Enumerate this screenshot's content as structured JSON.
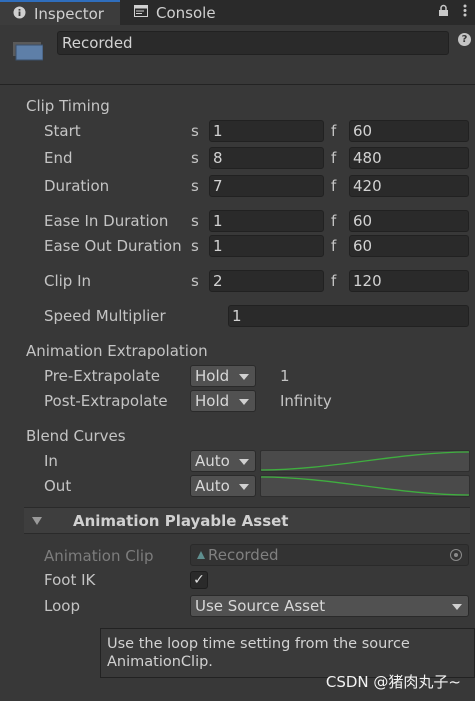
{
  "tabs": [
    {
      "label": "Inspector",
      "icon": "info-icon"
    },
    {
      "label": "Console",
      "icon": "console-icon"
    }
  ],
  "header": {
    "name_value": "Recorded",
    "help_glyph": "?"
  },
  "clip_timing": {
    "title": "Clip Timing",
    "s_unit": "s",
    "f_unit": "f",
    "start": {
      "label": "Start",
      "s": "1",
      "f": "60"
    },
    "end": {
      "label": "End",
      "s": "8",
      "f": "480"
    },
    "duration": {
      "label": "Duration",
      "s": "7",
      "f": "420"
    },
    "ease_in": {
      "label": "Ease In Duration",
      "s": "1",
      "f": "60"
    },
    "ease_out": {
      "label": "Ease Out Duration",
      "s": "1",
      "f": "60"
    },
    "clip_in": {
      "label": "Clip In",
      "s": "2",
      "f": "120"
    },
    "speed": {
      "label": "Speed Multiplier",
      "value": "1"
    }
  },
  "extrapolation": {
    "title": "Animation Extrapolation",
    "pre": {
      "label": "Pre-Extrapolate",
      "mode": "Hold",
      "value": "1"
    },
    "post": {
      "label": "Post-Extrapolate",
      "mode": "Hold",
      "value": "Infinity"
    }
  },
  "blend_curves": {
    "title": "Blend Curves",
    "in": {
      "label": "In",
      "mode": "Auto"
    },
    "out": {
      "label": "Out",
      "mode": "Auto"
    },
    "curve_color": "#3fae3f"
  },
  "playable_asset": {
    "title": "Animation Playable Asset",
    "clip_label": "Animation Clip",
    "clip_value": "Recorded",
    "foot_ik_label": "Foot IK",
    "foot_ik_checked": true,
    "check_glyph": "✓",
    "loop_label": "Loop",
    "loop_value": "Use Source Asset"
  },
  "tooltip": {
    "line1": "Use the loop time setting from the source",
    "line2": "AnimationClip."
  },
  "watermark": "CSDN @猪肉丸子~",
  "colors": {
    "accent": "#2f6ebd",
    "background": "#383838",
    "field": "#2a2a2a"
  }
}
